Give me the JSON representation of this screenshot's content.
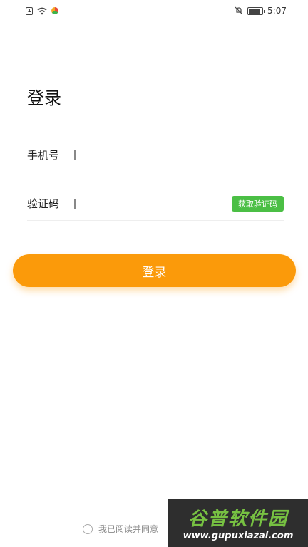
{
  "status_bar": {
    "time": "5:07",
    "sim_label": "1"
  },
  "page": {
    "title": "登录"
  },
  "form": {
    "phone_label": "手机号",
    "phone_value": "",
    "code_label": "验证码",
    "code_value": "",
    "get_code_label": "获取验证码",
    "submit_label": "登录"
  },
  "agreement": {
    "text": "我已阅读并同意"
  },
  "watermark": {
    "title": "谷普软件园",
    "url": "www.gupuxiazai.com"
  },
  "colors": {
    "primary": "#fb9a0a",
    "code_button": "#4bbf45"
  }
}
